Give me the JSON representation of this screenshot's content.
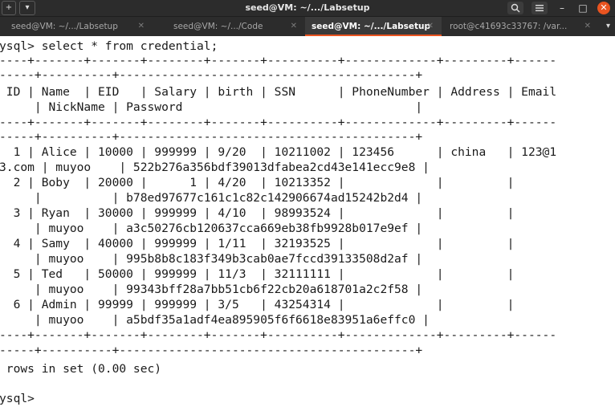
{
  "window": {
    "title": "seed@VM: ~/.../Labsetup",
    "new_tab_icon": "plus-icon",
    "menu_icon": "chevron-down-icon",
    "search_icon": "search-icon",
    "hamburger_icon": "hamburger-icon",
    "minimize_glyph": "–",
    "maximize_glyph": "□",
    "close_glyph": "✕"
  },
  "tabs": [
    {
      "label": "seed@VM: ~/.../Labsetup",
      "active": false
    },
    {
      "label": "seed@VM: ~/.../Code",
      "active": false
    },
    {
      "label": "seed@VM: ~/.../Labsetup",
      "active": true
    },
    {
      "label": "root@c41693c33767: /var...",
      "active": false
    }
  ],
  "tabs_more_icon": "chevron-down-icon",
  "terminal": {
    "lines": [
      "ysql> select * from credential;",
      "----+-------+-------+--------+-------+----------+-------------+---------+------",
      "-----+----------+------------------------------------------+",
      " ID | Name  | EID   | Salary | birth | SSN      | PhoneNumber | Address | Email",
      "     | NickName | Password                                 |",
      "----+-------+-------+--------+-------+----------+-------------+---------+------",
      "-----+----------+------------------------------------------+",
      "  1 | Alice | 10000 | 999999 | 9/20  | 10211002 | 123456      | china   | 123@1",
      "3.com | muyoo    | 522b276a356bdf39013dfabea2cd43e141ecc9e8 |",
      "  2 | Boby  | 20000 |      1 | 4/20  | 10213352 |             |         |",
      "     |          | b78ed97677c161c1c82c142906674ad15242b2d4 |",
      "  3 | Ryan  | 30000 | 999999 | 4/10  | 98993524 |             |         |",
      "     | muyoo    | a3c50276cb120637cca669eb38fb9928b017e9ef |",
      "  4 | Samy  | 40000 | 999999 | 1/11  | 32193525 |             |         |",
      "     | muyoo    | 995b8b8c183f349b3cab0ae7fccd39133508d2af |",
      "  5 | Ted   | 50000 | 999999 | 11/3  | 32111111 |             |         |",
      "     | muyoo    | 99343bff28a7bb51cb6f22cb20a618701a2c2f58 |",
      "  6 | Admin | 99999 | 999999 | 3/5   | 43254314 |             |         |",
      "     | muyoo    | a5bdf35a1adf4ea895905f6f6618e83951a6effc0 |",
      "----+-------+-------+--------+-------+----------+-------------+---------+------",
      "-----+----------+------------------------------------------+",
      " rows in set (0.00 sec)",
      "",
      "ysql>"
    ]
  }
}
